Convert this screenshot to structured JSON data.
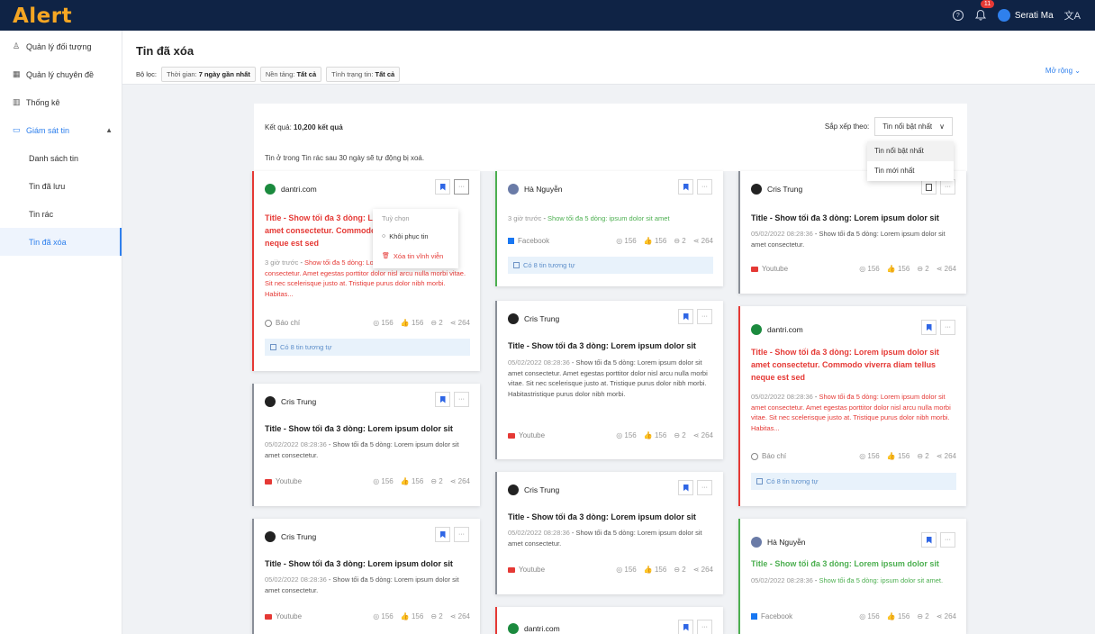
{
  "topbar": {
    "logo": "Alert",
    "notif_count": "11",
    "user_name": "Serati Ma",
    "lang_icon": "translate-icon",
    "help_icon": "help-icon"
  },
  "sidebar": {
    "items": [
      {
        "label": "Quản lý đối tượng",
        "icon": "user-icon"
      },
      {
        "label": "Quản lý chuyên đề",
        "icon": "table-icon"
      },
      {
        "label": "Thống kê",
        "icon": "chart-icon"
      },
      {
        "label": "Giám sát tin",
        "icon": "monitor-icon"
      },
      {
        "label": "Danh sách tin"
      },
      {
        "label": "Tin đã lưu"
      },
      {
        "label": "Tin rác"
      },
      {
        "label": "Tin đã xóa"
      }
    ]
  },
  "header": {
    "title": "Tin đã xóa",
    "filter_label": "Bộ lọc:",
    "filters": [
      {
        "key": "Thời gian:",
        "value": "7 ngày gần nhất"
      },
      {
        "key": "Nền tảng:",
        "value": "Tất cả"
      },
      {
        "key": "Tình trạng tin:",
        "value": "Tất cả"
      }
    ],
    "expand": "Mở rộng"
  },
  "results": {
    "label": "Kết quả:",
    "count": "10,200 kết quả",
    "sort_label": "Sắp xếp theo:",
    "sort_value": "Tin nổi bật nhất",
    "notice": "Tin ở trong Tin rác sau 30 ngày sẽ tự động bị xoá.",
    "sort_options": [
      "Tin nổi bật nhất",
      "Tin mới nhất"
    ]
  },
  "context_menu": {
    "title": "Tuỳ chọn",
    "restore": "Khôi phục tin",
    "delete": "Xóa tin vĩnh viễn"
  },
  "common": {
    "views": "156",
    "likes": "156",
    "comments": "2",
    "shares": "264",
    "similar": "Có 8 tin tương tự",
    "title_long": "Title - Show tối đa 3 dòng: Lorem ipsum dolor sit amet consectetur. Commodo viverra diam tellus neque est sed",
    "title_short": "Title - Show tối đa 3 dòng: Lorem ipsum dolor sit",
    "time": "05/02/2022 08:28:36",
    "time_rel": "3 giờ trước",
    "desc_short": "Show tối đa 5 dòng: Lorem ipsum dolor sit amet consectetur.",
    "desc_long": "Show tối đa 5 dòng: Lorem ipsum dolor sit amet consectetur. Amet egestas porttitor dolor nisl arcu nulla morbi vitae. Sit nec scelerisque justo at. Tristique purus dolor nibh morbi. Habitas...",
    "desc_long2": "Show tối đa 5 dòng: Lorem ipsum dolor sit amet consectetur. Amet egestas porttitor dolor nisl arcu nulla morbi vitae. Sit nec scelerisque justo at. Tristique purus dolor nibh morbi. Habitastristique purus dolor nibh morbi.",
    "desc_green1": "Show tối đa 5 dòng: ipsum dolor sit amet",
    "desc_green2": "Show tối đa 5 dòng: ipsum dolor sit amet."
  },
  "sources": {
    "dantri": "dantri.com",
    "cris": "Cris Trung",
    "ha": "Hà Nguyễn"
  },
  "platforms": {
    "bao_chi": "Báo chí",
    "youtube": "Youtube",
    "facebook": "Facebook"
  }
}
